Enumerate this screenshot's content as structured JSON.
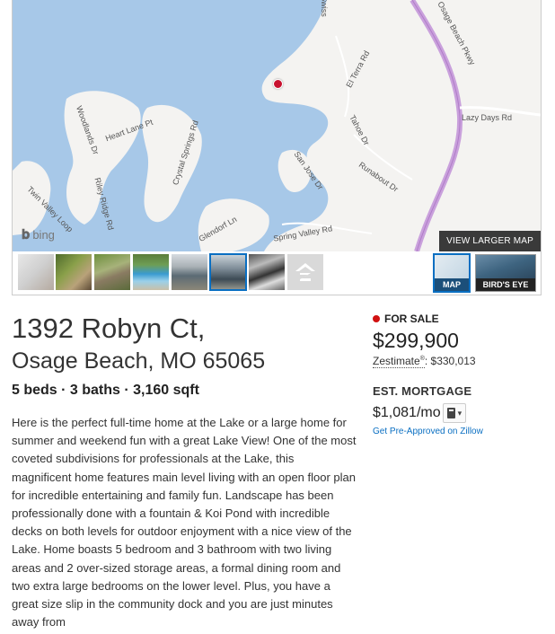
{
  "map": {
    "road_labels": [
      "Swiss",
      "Osage Beach Pkwy",
      "El Terra Rd",
      "Lazy Days Rd",
      "Woodlands Dr",
      "Heart Lane Pt",
      "Tahoe Dr",
      "Crystal Springs Rd",
      "San Jose Dr",
      "Runabout Dr",
      "Riley Ridge Rd",
      "Twin Valley Loop",
      "Glendorf Ln",
      "Spring Valley Rd"
    ],
    "provider": "bing",
    "larger_map_label": "VIEW LARGER MAP",
    "water_color": "#a7c8e8",
    "land_color": "#f4f3f1",
    "highway_color": "#c9a0dc"
  },
  "thumbs": {
    "map_label": "MAP",
    "birds_eye_label": "BIRD'S EYE",
    "zillow_icon": "zillow-logo-icon"
  },
  "listing": {
    "street": "1392 Robyn Ct,",
    "city_state_zip": "Osage Beach, MO 65065",
    "facts": "5 beds · 3 baths · 3,160 sqft",
    "description": "Here is the perfect full-time home at the Lake or a large home for summer and weekend fun with a great Lake View! One of the most coveted subdivisions for professionals at the Lake, this magnificent home features main level living with an open floor plan for incredible entertaining and family fun. Landscape has been professionally done with a fountain & Koi Pond with incredible decks on both levels for outdoor enjoyment with a nice view of the Lake. Home boasts 5 bedroom and 3 bathroom with two living areas and 2 over-sized storage areas, a formal dining room and two extra large bedrooms on the lower level. Plus, you have a great size slip in the community dock and you are just minutes away from"
  },
  "sidebar": {
    "status": "FOR SALE",
    "status_color": "#d11111",
    "price": "$299,900",
    "zestimate_label": "Zestimate",
    "zestimate_reg": "®",
    "zestimate_value": ": $330,013",
    "mortgage_heading": "EST. MORTGAGE",
    "mortgage_value": "$1,081/mo",
    "preapproved_link": "Get Pre-Approved on Zillow"
  }
}
